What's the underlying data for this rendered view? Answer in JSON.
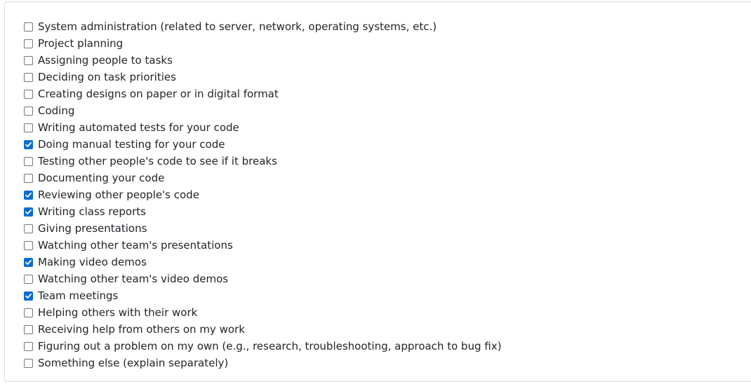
{
  "options": [
    {
      "label": "System administration (related to server, network, operating systems, etc.)",
      "checked": false
    },
    {
      "label": "Project planning",
      "checked": false
    },
    {
      "label": "Assigning people to tasks",
      "checked": false
    },
    {
      "label": "Deciding on task priorities",
      "checked": false
    },
    {
      "label": "Creating designs on paper or in digital format",
      "checked": false
    },
    {
      "label": "Coding",
      "checked": false
    },
    {
      "label": "Writing automated tests for your code",
      "checked": false
    },
    {
      "label": "Doing manual testing for your code",
      "checked": true
    },
    {
      "label": "Testing other people's code to see if it breaks",
      "checked": false
    },
    {
      "label": "Documenting your code",
      "checked": false
    },
    {
      "label": "Reviewing other people's code",
      "checked": true
    },
    {
      "label": "Writing class reports",
      "checked": true
    },
    {
      "label": "Giving presentations",
      "checked": false
    },
    {
      "label": "Watching other team's presentations",
      "checked": false
    },
    {
      "label": "Making video demos",
      "checked": true
    },
    {
      "label": "Watching other team's video demos",
      "checked": false
    },
    {
      "label": "Team meetings",
      "checked": true
    },
    {
      "label": "Helping others with their work",
      "checked": false
    },
    {
      "label": "Receiving help from others on my work",
      "checked": false
    },
    {
      "label": "Figuring out a problem on my own (e.g., research, troubleshooting, approach to bug fix)",
      "checked": false
    },
    {
      "label": "Something else (explain separately)",
      "checked": false
    }
  ],
  "colors": {
    "checked_fill": "#0a6ed1",
    "unchecked_border": "#767676",
    "text": "#212529",
    "panel_border": "#dcdcdc"
  },
  "icons": {
    "checkmark": "checkmark-icon"
  }
}
